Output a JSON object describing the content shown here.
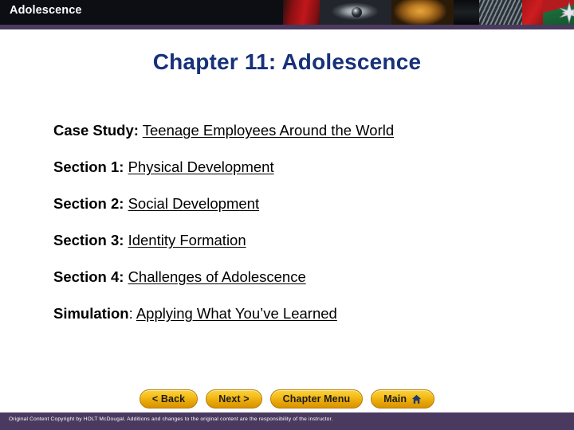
{
  "header": {
    "title": "Adolescence",
    "collage_alt": "photo-collage-eye-gold-star",
    "rule_color": "#493a5e",
    "background_color": "#0d0d14"
  },
  "page_title": "Chapter 11: Adolescence",
  "title_color": "#17317a",
  "content": {
    "rows": [
      {
        "label": "Case Study",
        "colon": ":",
        "link": "Teenage Employees Around the World",
        "colon_bold": true
      },
      {
        "label": "Section 1",
        "colon": ":",
        "link": "Physical Development",
        "colon_bold": true
      },
      {
        "label": "Section 2",
        "colon": ":",
        "link": "Social Development",
        "colon_bold": true
      },
      {
        "label": "Section 3",
        "colon": ":",
        "link": "Identity Formation",
        "colon_bold": true
      },
      {
        "label": "Section 4",
        "colon": ":",
        "link": "Challenges of Adolescence",
        "colon_bold": true
      },
      {
        "label": "Simulation",
        "colon": ":",
        "link": "Applying What You’ve Learned",
        "colon_bold": false
      }
    ]
  },
  "nav": {
    "buttons": [
      {
        "label": "< Back",
        "icon": ""
      },
      {
        "label": "Next >",
        "icon": ""
      },
      {
        "label": "Chapter Menu",
        "icon": ""
      },
      {
        "label": "Main",
        "icon": "home-icon"
      }
    ],
    "button_color": "#f5c01d",
    "button_text_color": "#1c1c1c",
    "home_icon_color": "#1f3a6e"
  },
  "footer": {
    "text": "Original Content Copyright by HOLT McDougal. Additions and changes to the original content are the responsibility of the instructor.",
    "background_color": "#4a3a60"
  }
}
